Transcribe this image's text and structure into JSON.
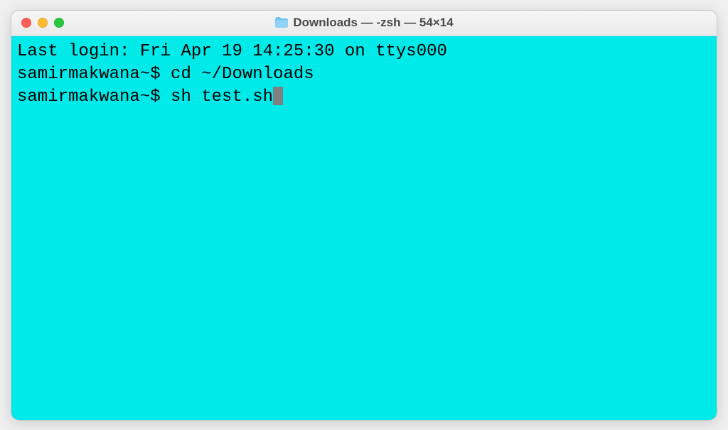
{
  "window": {
    "title": "Downloads — -zsh — 54×14"
  },
  "terminal": {
    "lines": [
      {
        "text": "Last login: Fri Apr 19 14:25:30 on ttys000"
      },
      {
        "prompt": "samirmakwana~$ ",
        "command": "cd ~/Downloads"
      },
      {
        "prompt": "samirmakwana~$ ",
        "command": "sh test.sh",
        "cursor": true
      }
    ]
  }
}
